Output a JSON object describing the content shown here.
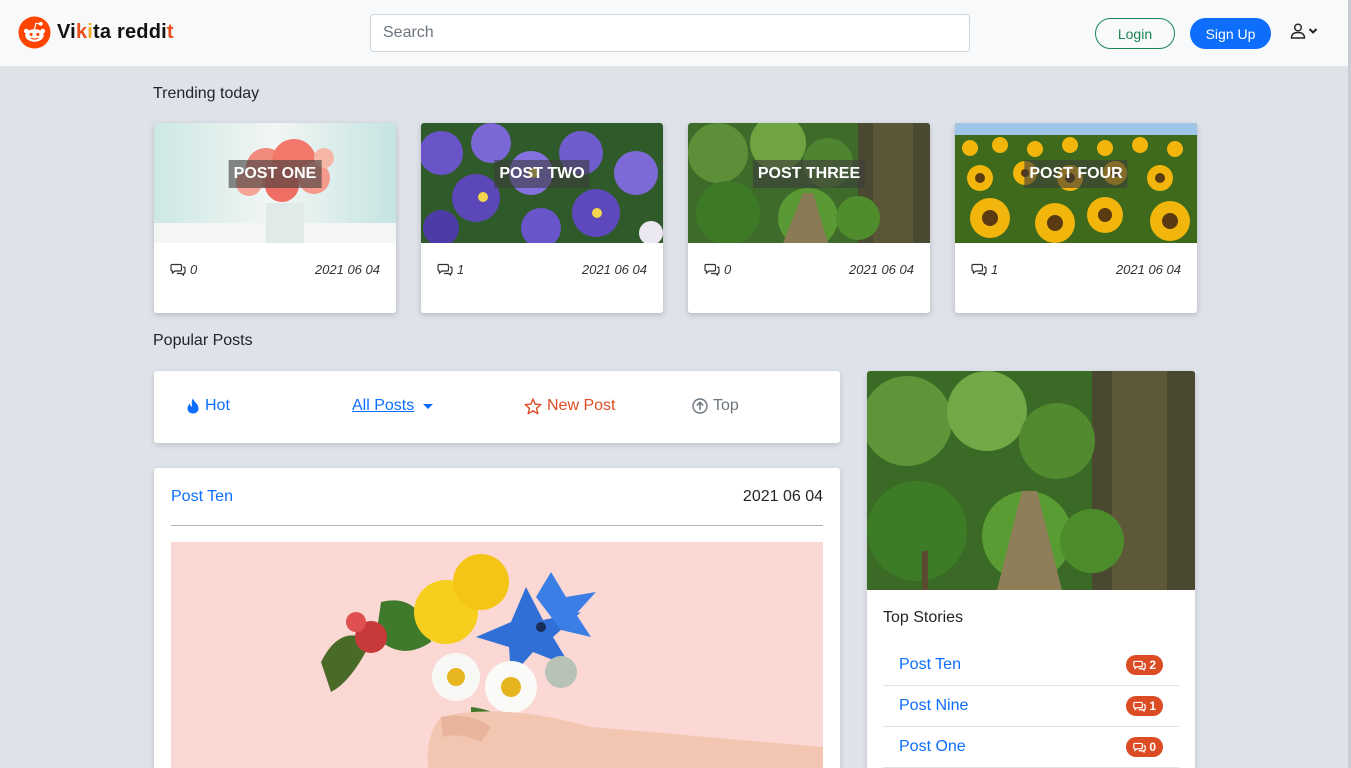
{
  "brand": {
    "name_part1": "Vi",
    "name_part2": "k",
    "name_part3": "i",
    "name_part4": "ta reddi",
    "name_part5": "t",
    "icon": "reddit-alien-icon"
  },
  "search": {
    "placeholder": "Search"
  },
  "auth": {
    "login_label": "Login",
    "signup_label": "Sign Up",
    "user_icon": "user-icon"
  },
  "colors": {
    "primary": "#0d6efd",
    "success": "#198754",
    "accent": "#dc4c24",
    "background": "#dee2e9"
  },
  "trending": {
    "title": "Trending today",
    "cards": [
      {
        "label": "POST ONE",
        "comments": "0",
        "date": "2021 06 04",
        "image": "pink-flowers-in-vase"
      },
      {
        "label": "POST TWO",
        "comments": "1",
        "date": "2021 06 04",
        "image": "purple-pansies"
      },
      {
        "label": "POST THREE",
        "comments": "0",
        "date": "2021 06 04",
        "image": "forest-trail"
      },
      {
        "label": "POST FOUR",
        "comments": "1",
        "date": "2021 06 04",
        "image": "sunflower-field"
      }
    ]
  },
  "popular": {
    "title": "Popular Posts",
    "filters": {
      "hot": "Hot",
      "all_posts": "All Posts",
      "new_post": "New Post",
      "top": "Top"
    }
  },
  "post": {
    "title": "Post Ten",
    "date": "2021 06 04",
    "image": "hand-holding-flower-bouquet"
  },
  "sidebar": {
    "image": "forest-trail",
    "title": "Top Stories",
    "stories": [
      {
        "label": "Post Ten",
        "count": "2"
      },
      {
        "label": "Post Nine",
        "count": "1"
      },
      {
        "label": "Post One",
        "count": "0"
      }
    ]
  }
}
